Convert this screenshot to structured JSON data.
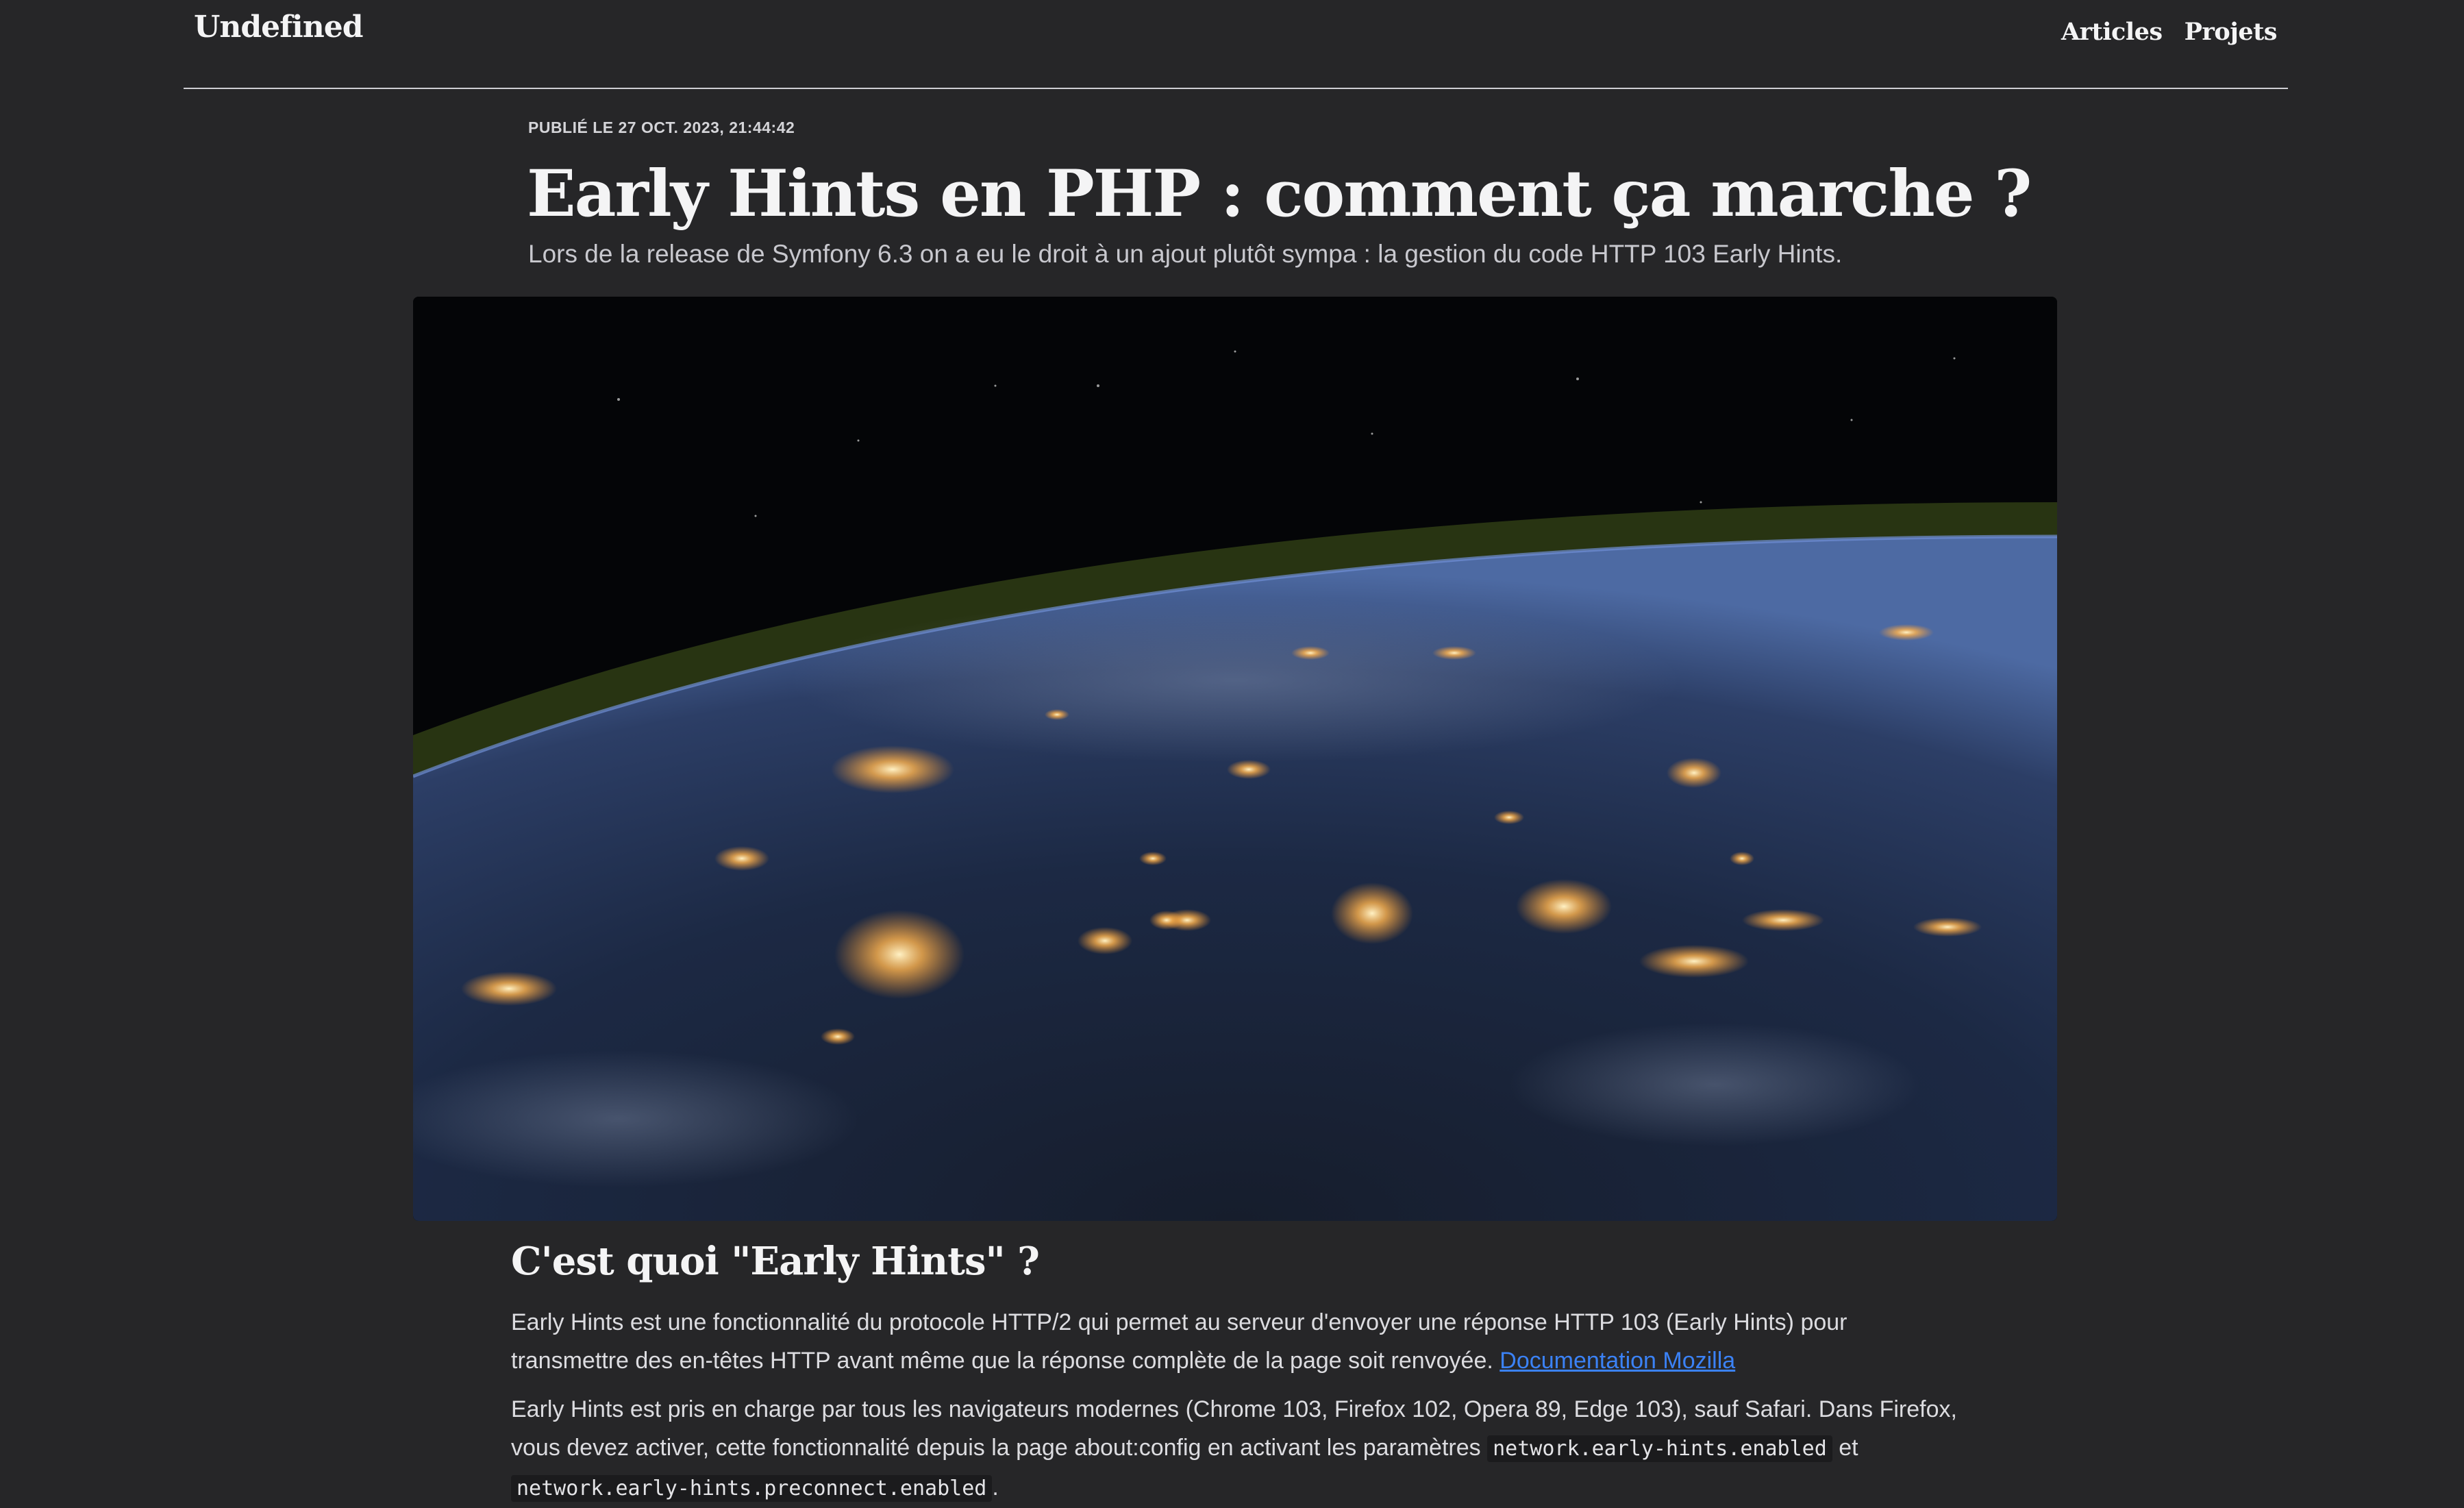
{
  "header": {
    "brand": "Undefined",
    "nav": [
      "Articles",
      "Projets"
    ]
  },
  "article": {
    "meta": "PUBLIÉ LE 27 OCT. 2023, 21:44:42",
    "title": "Early Hints en PHP : comment ça marche ?",
    "lead": "Lors de la release de Symfony 6.3 on a eu le droit à un ajout plutôt sympa : la gestion du code HTTP 103 Early Hints.",
    "hero_image": "earth-at-night-from-space-photo",
    "section_heading": "C'est quoi \"Early Hints\" ?",
    "p1_text": "Early Hints est une fonctionnalité du protocole HTTP/2 qui permet au serveur d'envoyer une réponse HTTP 103 (Early Hints) pour transmettre des en-têtes HTTP avant même que la réponse complète de la page soit renvoyée.",
    "p1_link": "Documentation Mozilla",
    "p2_text": "Early Hints est pris en charge par tous les navigateurs modernes (Chrome 103, Firefox 102, Opera 89, Edge 103), sauf Safari. Dans Firefox, vous devez activer, cette fonctionnalité depuis la page about:config en activant les paramètres",
    "p2_code1": "network.early-hints.enabled",
    "p2_and": "et",
    "p2_code2": "network.early-hints.preconnect.enabled",
    "p2_end": "."
  },
  "colors": {
    "background": "#262628",
    "text": "#e4e4e7",
    "link": "#3b82f6"
  }
}
